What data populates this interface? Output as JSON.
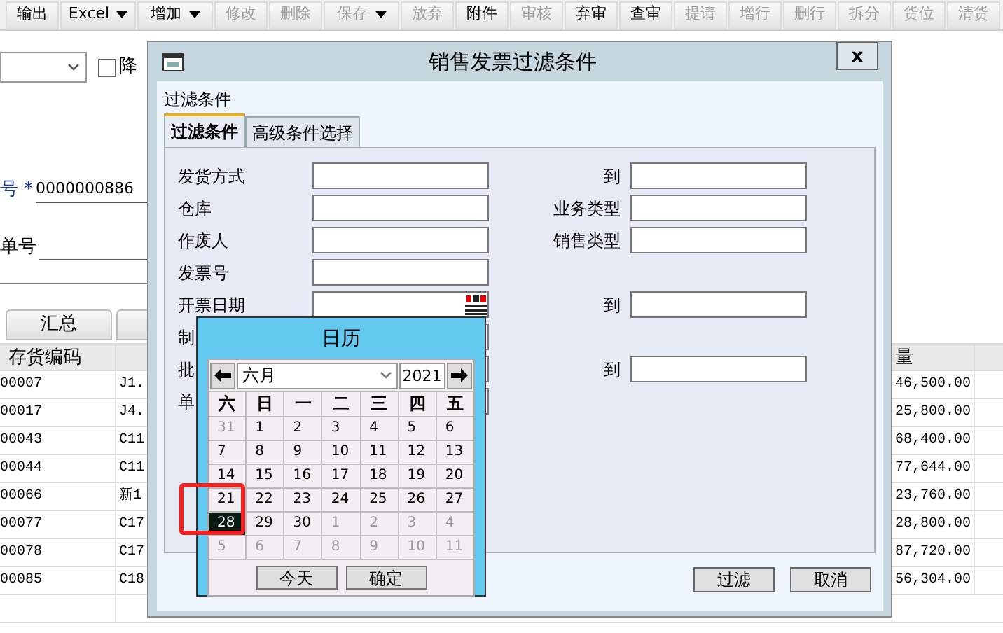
{
  "toolbar": {
    "buttons": [
      {
        "label": "输出",
        "disabled": false,
        "dropdown": false
      },
      {
        "label": "Excel",
        "disabled": false,
        "dropdown": true
      },
      {
        "label": "增加",
        "disabled": false,
        "dropdown": true
      },
      {
        "label": "修改",
        "disabled": true,
        "dropdown": false
      },
      {
        "label": "删除",
        "disabled": true,
        "dropdown": false
      },
      {
        "label": "保存",
        "disabled": true,
        "dropdown": true
      },
      {
        "label": "放弃",
        "disabled": true,
        "dropdown": false
      },
      {
        "label": "附件",
        "disabled": false,
        "dropdown": false
      },
      {
        "label": "审核",
        "disabled": true,
        "dropdown": false
      },
      {
        "label": "弃审",
        "disabled": false,
        "dropdown": false
      },
      {
        "label": "查审",
        "disabled": false,
        "dropdown": false
      },
      {
        "label": "提请",
        "disabled": true,
        "dropdown": false
      },
      {
        "label": "增行",
        "disabled": true,
        "dropdown": false
      },
      {
        "label": "删行",
        "disabled": true,
        "dropdown": false
      },
      {
        "label": "拆分",
        "disabled": true,
        "dropdown": false
      },
      {
        "label": "货位",
        "disabled": true,
        "dropdown": false
      },
      {
        "label": "清货",
        "disabled": true,
        "dropdown": false
      }
    ]
  },
  "form": {
    "sort_checkbox": {
      "label": "降",
      "checked": false
    },
    "fields": [
      {
        "label": "号",
        "required_mark": "*",
        "value": "0000000886"
      },
      {
        "label": "单号"
      }
    ]
  },
  "tabs": [
    {
      "label": "汇总",
      "selected": true
    }
  ],
  "table": {
    "columns": [
      "存货编码",
      "量"
    ],
    "rows": [
      {
        "code": "00007",
        "column_2": "J1.",
        "quantity": "46,500.00"
      },
      {
        "code": "00017",
        "column_2": "J4.",
        "quantity": "25,800.00"
      },
      {
        "code": "00043",
        "column_2": "C11",
        "quantity": "68,400.00"
      },
      {
        "code": "00044",
        "column_2": "C11",
        "quantity": "77,644.00"
      },
      {
        "code": "00066",
        "column_2": "新1",
        "quantity": "23,760.00"
      },
      {
        "code": "00077",
        "column_2": "C17",
        "quantity": "28,800.00"
      },
      {
        "code": "00078",
        "column_2": "C17",
        "quantity": "87,720.00"
      },
      {
        "code": "00085",
        "column_2": "C18",
        "quantity": "56,304.00"
      }
    ]
  },
  "dialog": {
    "title": "销售发票过滤条件",
    "close": "x",
    "section_label": "过滤条件",
    "tabs": [
      {
        "label": "过滤条件",
        "selected": true
      },
      {
        "label": "高级条件选择",
        "selected": false
      }
    ],
    "rows": [
      {
        "left": {
          "label": "发货方式",
          "kind": "text"
        },
        "right": {
          "label": "到"
        }
      },
      {
        "left": {
          "label": "仓库",
          "kind": "text"
        },
        "right": {
          "label": "业务类型"
        }
      },
      {
        "left": {
          "label": "作废人",
          "kind": "text"
        },
        "right": {
          "label": "销售类型"
        }
      },
      {
        "left": {
          "label": "发票号",
          "kind": "text"
        }
      },
      {
        "left": {
          "label": "开票日期",
          "kind": "date"
        },
        "right": {
          "label": "到"
        }
      },
      {
        "left": {
          "label": "制",
          "kind": "text"
        }
      },
      {
        "left": {
          "label": "批",
          "kind": "text"
        },
        "right": {
          "label": "到"
        }
      },
      {
        "left": {
          "label": "单",
          "kind": "text"
        }
      }
    ],
    "buttons": [
      "过滤",
      "取消"
    ]
  },
  "calendar": {
    "title": "日历",
    "month": "六月",
    "year": "2021",
    "weekdays": [
      "六",
      "日",
      "一",
      "二",
      "三",
      "四",
      "五"
    ],
    "days": [
      {
        "label": "31",
        "muted": true,
        "selected": false
      },
      {
        "label": "1",
        "muted": false,
        "selected": false
      },
      {
        "label": "2",
        "muted": false,
        "selected": false
      },
      {
        "label": "3",
        "muted": false,
        "selected": false
      },
      {
        "label": "4",
        "muted": false,
        "selected": false
      },
      {
        "label": "5",
        "muted": false,
        "selected": false
      },
      {
        "label": "6",
        "muted": false,
        "selected": false
      },
      {
        "label": "7",
        "muted": false,
        "selected": false
      },
      {
        "label": "8",
        "muted": false,
        "selected": false
      },
      {
        "label": "9",
        "muted": false,
        "selected": false
      },
      {
        "label": "10",
        "muted": false,
        "selected": false
      },
      {
        "label": "11",
        "muted": false,
        "selected": false
      },
      {
        "label": "12",
        "muted": false,
        "selected": false
      },
      {
        "label": "13",
        "muted": false,
        "selected": false
      },
      {
        "label": "14",
        "muted": false,
        "selected": false
      },
      {
        "label": "15",
        "muted": false,
        "selected": false
      },
      {
        "label": "16",
        "muted": false,
        "selected": false
      },
      {
        "label": "17",
        "muted": false,
        "selected": false
      },
      {
        "label": "18",
        "muted": false,
        "selected": false
      },
      {
        "label": "19",
        "muted": false,
        "selected": false
      },
      {
        "label": "20",
        "muted": false,
        "selected": false
      },
      {
        "label": "21",
        "muted": false,
        "selected": false
      },
      {
        "label": "22",
        "muted": false,
        "selected": false
      },
      {
        "label": "23",
        "muted": false,
        "selected": false
      },
      {
        "label": "24",
        "muted": false,
        "selected": false
      },
      {
        "label": "25",
        "muted": false,
        "selected": false
      },
      {
        "label": "26",
        "muted": false,
        "selected": false
      },
      {
        "label": "27",
        "muted": false,
        "selected": false
      },
      {
        "label": "28",
        "muted": false,
        "selected": true
      },
      {
        "label": "29",
        "muted": false,
        "selected": false
      },
      {
        "label": "30",
        "muted": false,
        "selected": false
      },
      {
        "label": "1",
        "muted": true,
        "selected": false
      },
      {
        "label": "2",
        "muted": true,
        "selected": false
      },
      {
        "label": "3",
        "muted": true,
        "selected": false
      },
      {
        "label": "4",
        "muted": true,
        "selected": false
      },
      {
        "label": "5",
        "muted": true,
        "selected": false
      },
      {
        "label": "6",
        "muted": true,
        "selected": false
      },
      {
        "label": "7",
        "muted": true,
        "selected": false
      },
      {
        "label": "8",
        "muted": true,
        "selected": false
      },
      {
        "label": "9",
        "muted": true,
        "selected": false
      },
      {
        "label": "10",
        "muted": true,
        "selected": false
      },
      {
        "label": "11",
        "muted": true,
        "selected": false
      }
    ],
    "buttons": [
      "今天",
      "确定"
    ]
  }
}
